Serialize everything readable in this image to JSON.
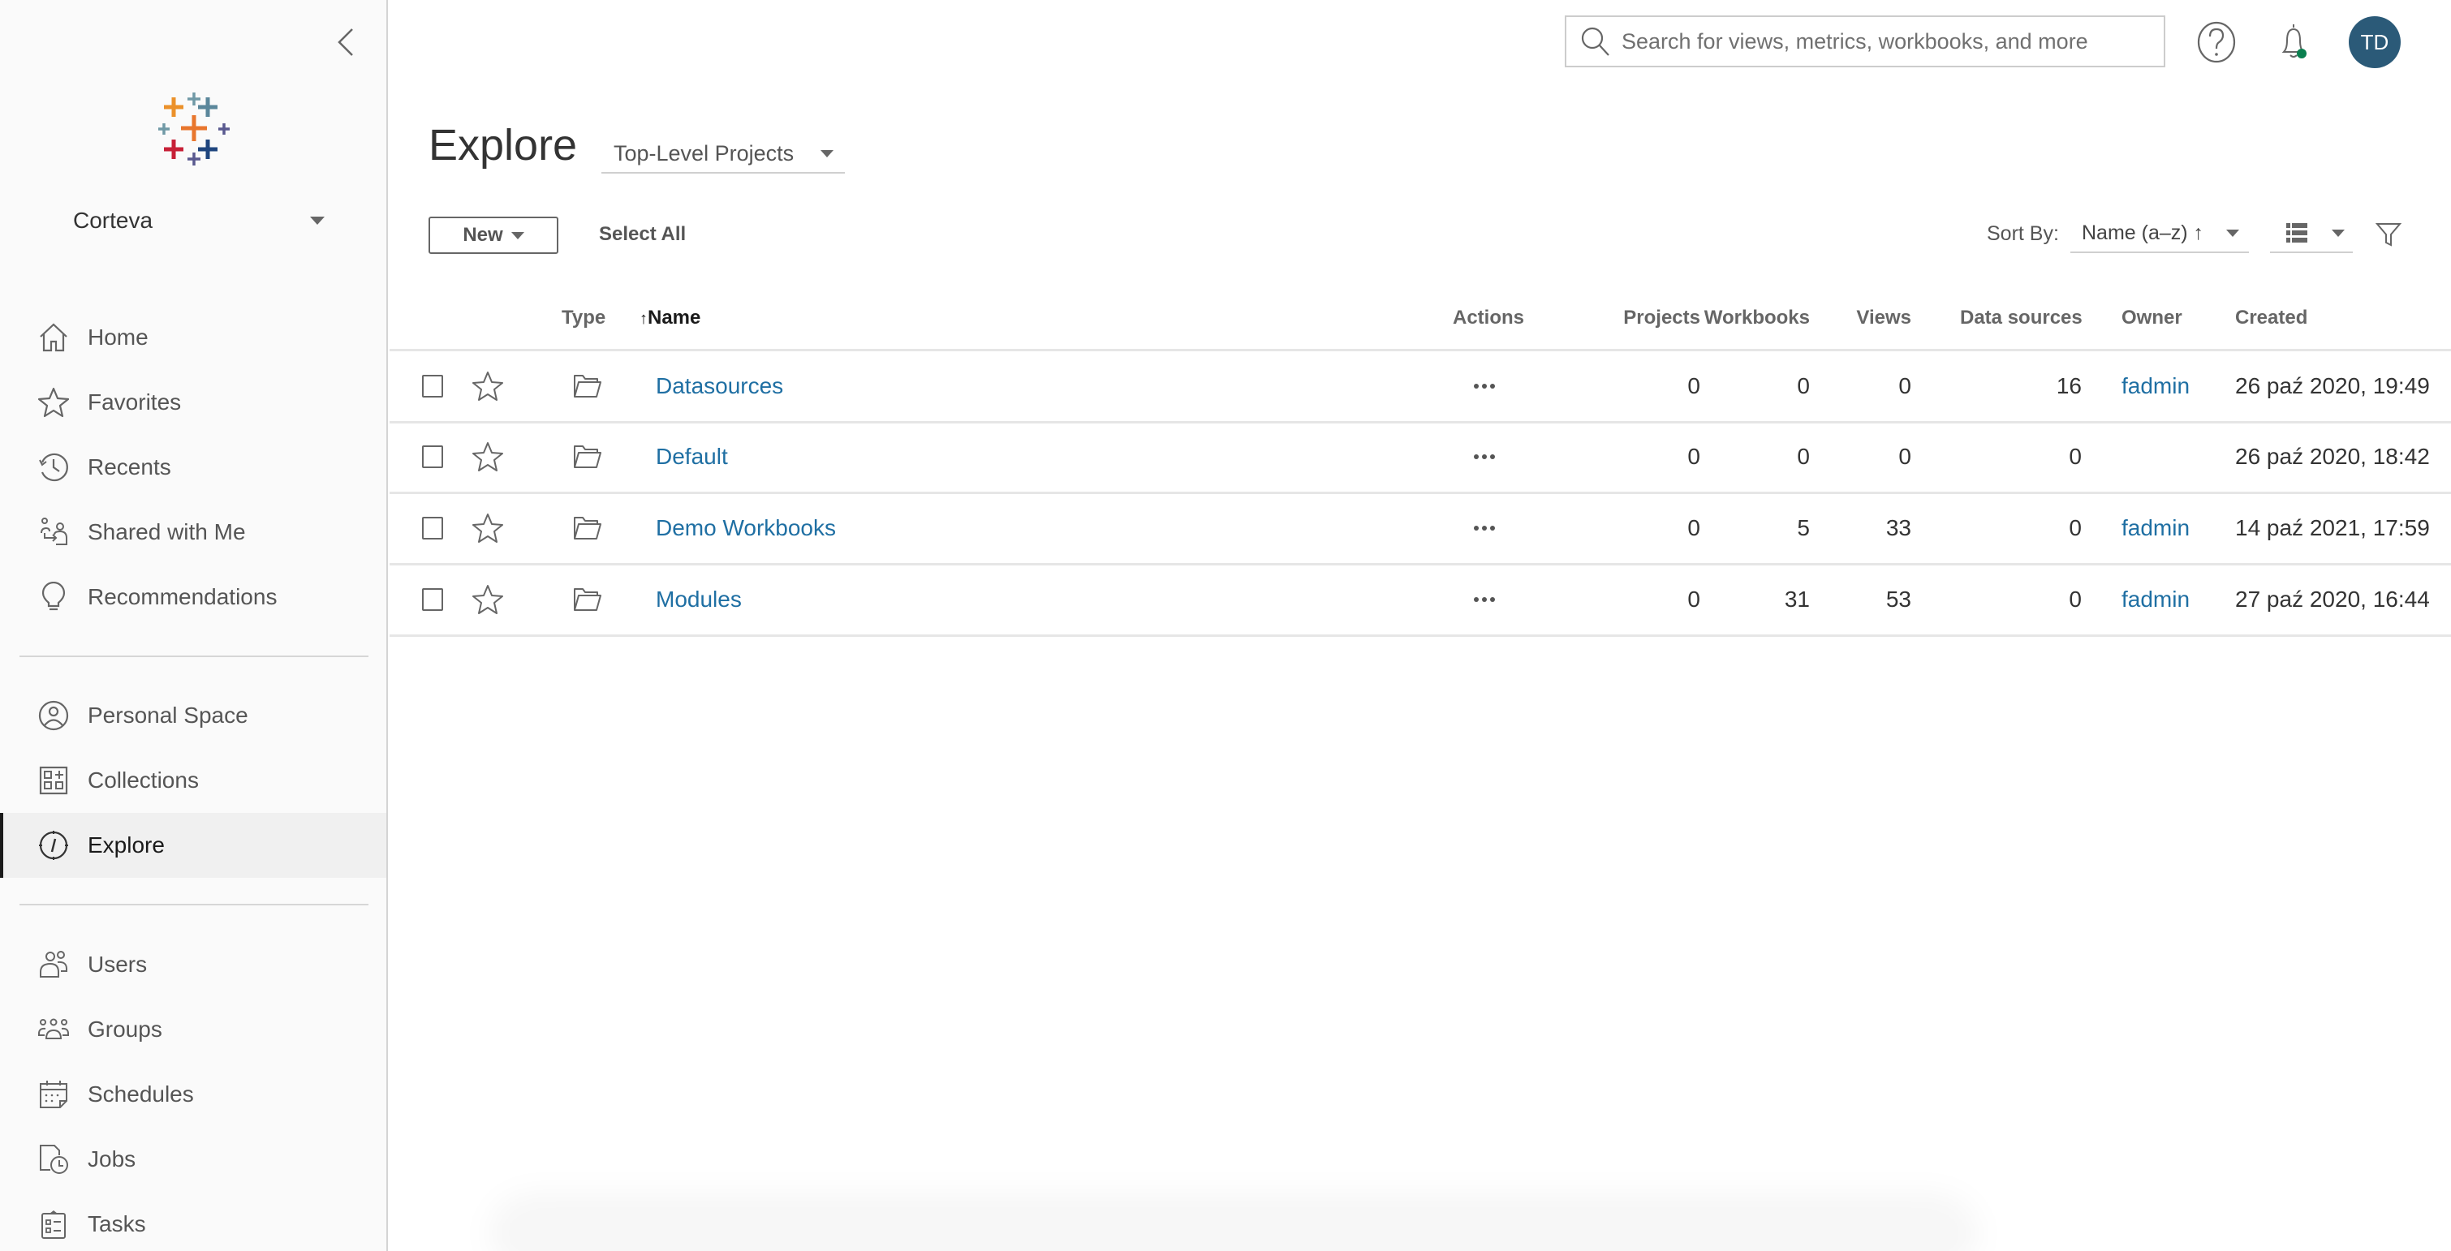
{
  "sidebar": {
    "collapse_icon": "chevron-left-icon",
    "logo_icon": "tableau-logo-icon",
    "site": {
      "label": "Corteva",
      "icon": "caret-down-icon"
    },
    "groups": [
      [
        {
          "label": "Home",
          "icon": "home-icon"
        },
        {
          "label": "Favorites",
          "icon": "star-icon"
        },
        {
          "label": "Recents",
          "icon": "history-icon"
        },
        {
          "label": "Shared with Me",
          "icon": "shared-icon"
        },
        {
          "label": "Recommendations",
          "icon": "lightbulb-icon"
        }
      ],
      [
        {
          "label": "Personal Space",
          "icon": "user-circle-icon"
        },
        {
          "label": "Collections",
          "icon": "collections-icon"
        },
        {
          "label": "Explore",
          "icon": "compass-icon",
          "active": true
        }
      ],
      [
        {
          "label": "Users",
          "icon": "users-icon"
        },
        {
          "label": "Groups",
          "icon": "groups-icon"
        },
        {
          "label": "Schedules",
          "icon": "calendar-icon"
        },
        {
          "label": "Jobs",
          "icon": "jobs-icon"
        },
        {
          "label": "Tasks",
          "icon": "clipboard-icon"
        }
      ]
    ]
  },
  "header": {
    "search": {
      "placeholder": "Search for views, metrics, workbooks, and more",
      "value": ""
    },
    "help_icon": "help-icon",
    "notifications_icon": "bell-icon",
    "notification_dot_color": "#0a7f4f",
    "avatar": {
      "initials": "TD",
      "color": "#2b5a78"
    }
  },
  "page": {
    "title": "Explore",
    "scope_dropdown": {
      "selected": "Top-Level Projects"
    }
  },
  "toolbar": {
    "new_label": "New",
    "select_all_label": "Select All",
    "sort_by_label": "Sort By:",
    "sort_selected": "Name (a–z) ↑",
    "view_icon": "list-view-icon",
    "filter_icon": "filter-icon"
  },
  "table": {
    "columns": {
      "type": "Type",
      "name": "Name",
      "name_sort_indicator": "↑",
      "actions": "Actions",
      "projects": "Projects",
      "workbooks": "Workbooks",
      "views": "Views",
      "data_sources": "Data sources",
      "owner": "Owner",
      "created": "Created"
    },
    "rows": [
      {
        "type_icon": "folder-icon",
        "name": "Datasources",
        "projects": "0",
        "workbooks": "0",
        "views": "0",
        "data_sources": "16",
        "owner": "fadmin",
        "created": "26 paź 2020, 19:49"
      },
      {
        "type_icon": "folder-icon",
        "name": "Default",
        "projects": "0",
        "workbooks": "0",
        "views": "0",
        "data_sources": "0",
        "owner": "",
        "created": "26 paź 2020, 18:42"
      },
      {
        "type_icon": "folder-icon",
        "name": "Demo Workbooks",
        "projects": "0",
        "workbooks": "5",
        "views": "33",
        "data_sources": "0",
        "owner": "fadmin",
        "created": "14 paź 2021, 17:59"
      },
      {
        "type_icon": "folder-icon",
        "name": "Modules",
        "projects": "0",
        "workbooks": "31",
        "views": "53",
        "data_sources": "0",
        "owner": "fadmin",
        "created": "27 paź 2020, 16:44"
      }
    ]
  },
  "colors": {
    "link": "#1f6fa3",
    "sidebar_bg": "#fafafa",
    "active_nav_bg": "#f0f0f0",
    "avatar": "#2b5a78"
  }
}
